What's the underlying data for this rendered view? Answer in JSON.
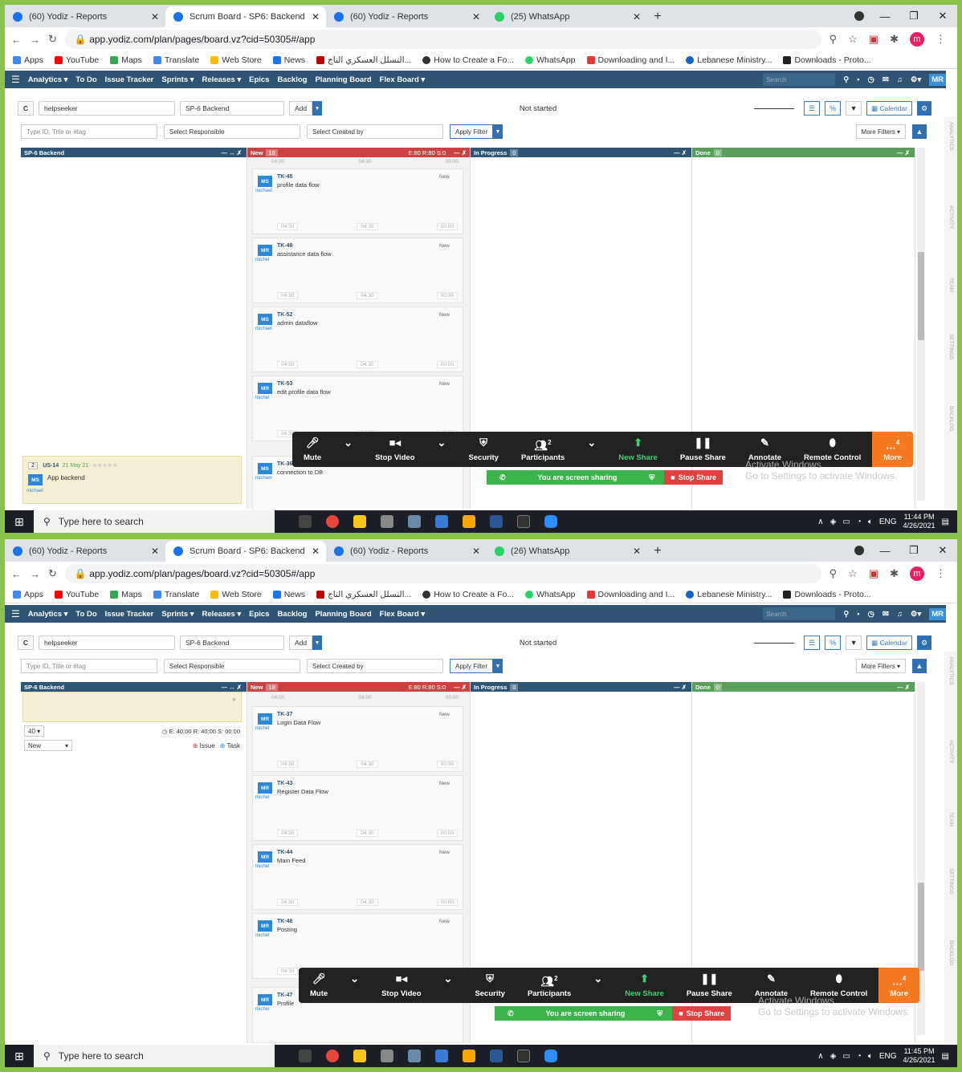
{
  "screens": [
    {
      "tabs": [
        {
          "label": "(60) Yodiz - Reports"
        },
        {
          "label": "Scrum Board - SP6: Backend"
        },
        {
          "label": "(60) Yodiz - Reports"
        },
        {
          "label": "(25) WhatsApp"
        }
      ],
      "cards": [
        {
          "id": "TK-45",
          "title": "profile data flow",
          "initials": "MS",
          "owner": "michael",
          "status": "New"
        },
        {
          "id": "TK-48",
          "title": "assistance data flow",
          "initials": "MR",
          "owner": "michel",
          "status": "New"
        },
        {
          "id": "TK-52",
          "title": "admin dataflow",
          "initials": "MS",
          "owner": "michael",
          "status": "New"
        },
        {
          "id": "TK-53",
          "title": "edit profile data flow",
          "initials": "MR",
          "owner": "michel",
          "status": "New"
        }
      ],
      "partial_card": {
        "id": "TK-36",
        "title": "connection to DB",
        "initials": "MS",
        "owner": "michael"
      },
      "story": {
        "num": "2",
        "id": "US-14",
        "date": "21 May 21",
        "stars": "★★★★★",
        "title": "App backend",
        "initials": "MS",
        "owner": "michael"
      },
      "time": "11:44 PM",
      "date": "4/26/2021"
    },
    {
      "tabs": [
        {
          "label": "(60) Yodiz - Reports"
        },
        {
          "label": "Scrum Board - SP6: Backend"
        },
        {
          "label": "(60) Yodiz - Reports"
        },
        {
          "label": "(26) WhatsApp"
        }
      ],
      "cards": [
        {
          "id": "TK-37",
          "title": "Login Data Flow",
          "initials": "MR",
          "owner": "michel",
          "status": "New"
        },
        {
          "id": "TK-43",
          "title": "Register Data Flow",
          "initials": "MR",
          "owner": "michel",
          "status": "New"
        },
        {
          "id": "TK-44",
          "title": "Main Feed",
          "initials": "MR",
          "owner": "michel",
          "status": "New"
        },
        {
          "id": "TK-46",
          "title": "Posting",
          "initials": "MR",
          "owner": "michel",
          "status": "New"
        }
      ],
      "partial_card": {
        "id": "TK-47",
        "title": "Profile",
        "initials": "MR",
        "owner": "michel"
      },
      "story_controls": {
        "points": "40",
        "estimates": "E: 40:00  R: 40:00  S: 00:00",
        "status": "New",
        "issue": "Issue",
        "task": "Task"
      },
      "time": "11:45 PM",
      "date": "4/26/2021"
    }
  ],
  "browser": {
    "url": "app.yodiz.com/plan/pages/board.vz?cid=50305#/app",
    "avatar": "m",
    "bookmarks": [
      "Apps",
      "YouTube",
      "Maps",
      "Translate",
      "Web Store",
      "News",
      "التسلل العسكري الناج...",
      "How to Create a Fo...",
      "WhatsApp",
      "Downloading and I...",
      "Lebanese Ministry...",
      "Downloads - Proto..."
    ]
  },
  "nav": {
    "items": [
      "Analytics ▾",
      "To Do",
      "Issue Tracker",
      "Sprints ▾",
      "Releases ▾",
      "Epics",
      "Backlog",
      "Planning Board",
      "Flex Board ▾"
    ],
    "search_placeholder": "Search",
    "user": "MR"
  },
  "toolbar": {
    "project": "helpseeker",
    "sprint": "SP-6 Backend",
    "add": "Add",
    "state": "Not started",
    "calendar": "Calendar"
  },
  "filters": {
    "search_placeholder": "Type ID, Title or #tag",
    "responsible": "Select Responsible",
    "created_by": "Select Created by",
    "apply": "Apply Filter",
    "more": "More Filters ▾"
  },
  "columns": {
    "sprint": "SP-6 Backend",
    "new": "New",
    "new_count": "18",
    "new_est": "E:80  R:80  S:0",
    "progress": "In Progress",
    "progress_count": "0",
    "done": "Done",
    "done_count": "0"
  },
  "card_times": {
    "e": "04:30",
    "r": "04:30",
    "s": "00:00"
  },
  "card_times_top": {
    "e": "04:00",
    "r": "04:00",
    "s": "00:00"
  },
  "side_tabs": [
    "ANALYTICS",
    "ACTIVITY",
    "TEAM",
    "SETTINGS",
    "BACKLOG"
  ],
  "zoom": {
    "mute": "Mute",
    "stop_video": "Stop Video",
    "security": "Security",
    "participants": "Participants",
    "participants_count": "2",
    "new_share": "New Share",
    "pause_share": "Pause Share",
    "annotate": "Annotate",
    "remote_control": "Remote Control",
    "more": "More",
    "more_count": "4",
    "sharing": "You are screen sharing",
    "stop_share": "Stop Share"
  },
  "activate": {
    "line1": "Activate Windows",
    "line2": "Go to Settings to activate Windows."
  },
  "taskbar": {
    "search": "Type here to search",
    "lang": "ENG"
  }
}
